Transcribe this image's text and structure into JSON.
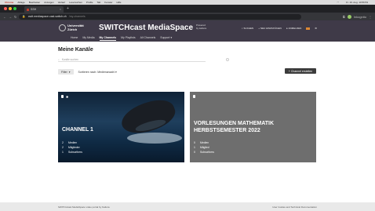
{
  "menubar": {
    "app": "Chrome",
    "items": [
      "Ablage",
      "Bearbeiten",
      "Anzeigen",
      "Verlauf",
      "Lesezeichen",
      "Profile",
      "Tab",
      "Fenster",
      "Hilfe"
    ],
    "clock": "Fr. 19. Aug. 10:56:53"
  },
  "tabs": [
    {
      "label": "SSH",
      "favicon": "switch-favicon"
    }
  ],
  "address": {
    "url_host": "csdt.mediaspace.cast.switch.ch",
    "url_path": "/my-channels",
    "profile_label": "Inkognito"
  },
  "header": {
    "logo_line1": "Universität",
    "logo_line2": "Zürich",
    "title": "SWITCHcast MediaSpace",
    "powered_line1": "Powered",
    "powered_line2": "by kaltura",
    "actions": [
      "SUCHEN",
      "NEU HINZUFÜGEN",
      "ANMELDEN"
    ],
    "nav": [
      "Home",
      "My Media",
      "My Channels",
      "My Playlists",
      "All Channels",
      "Support"
    ]
  },
  "page": {
    "title": "Meine Kanäle",
    "search_placeholder": "Kanäle suchen",
    "filter_label": "Filter",
    "sort_label": "Sortieren nach: Medienanzahl",
    "create_label": "+ Channel erstellen"
  },
  "channels": [
    {
      "title": "CHANNEL 1",
      "media": "2",
      "members": "2",
      "subscribers": "1",
      "media_label": "Medien",
      "members_label": "Mitglieder",
      "subscribers_label": "Subscribers"
    },
    {
      "title": "VORLESUNGEN MATHEMATIK HERBSTSEMESTER 2022",
      "media": "0",
      "members": "1",
      "subscribers": "0",
      "media_label": "Medien",
      "members_label": "Mitglied",
      "subscribers_label": "Subscribers"
    }
  ],
  "footer": {
    "left": "SWITCHcast MediaSpace video portal by Kaltura",
    "right": "User Guides and Technical Documentation"
  },
  "colors": {
    "header": "#3f3a48",
    "create_button": "#3c3c3c",
    "card2": "#6e6e6e"
  }
}
